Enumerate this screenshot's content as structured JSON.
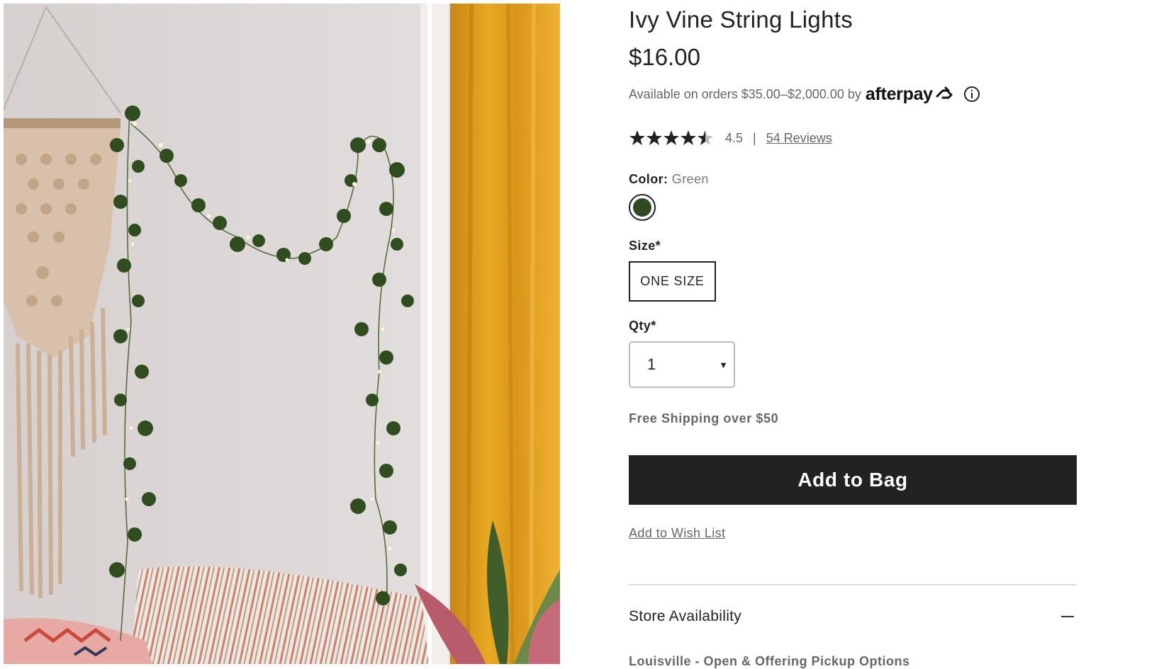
{
  "product": {
    "title": "Ivy Vine String Lights",
    "price": "$16.00",
    "image_alt": "ivy-vine-string-lights-photo"
  },
  "afterpay": {
    "text": "Available on orders $35.00–$2,000.00 by",
    "brand": "afterpay",
    "info_icon": "info-icon"
  },
  "rating": {
    "value": "4.5",
    "separator": "|",
    "reviews_link": "54 Reviews",
    "stars": 4.5
  },
  "color": {
    "label": "Color:",
    "value": "Green",
    "swatch_hex": "#2f4a22"
  },
  "size": {
    "label": "Size*",
    "option": "ONE SIZE"
  },
  "qty": {
    "label": "Qty*",
    "value": "1",
    "arrow": "▼"
  },
  "shipping": "Free Shipping over $50",
  "actions": {
    "add_to_bag": "Add to Bag",
    "wish_list": "Add to Wish List"
  },
  "store": {
    "title": "Store Availability",
    "location": "Louisville - Open & Offering Pickup Options"
  },
  "colors": {
    "text": "#222222",
    "muted": "#666666",
    "button_bg": "#222222",
    "curtain": "#e2a21e"
  }
}
